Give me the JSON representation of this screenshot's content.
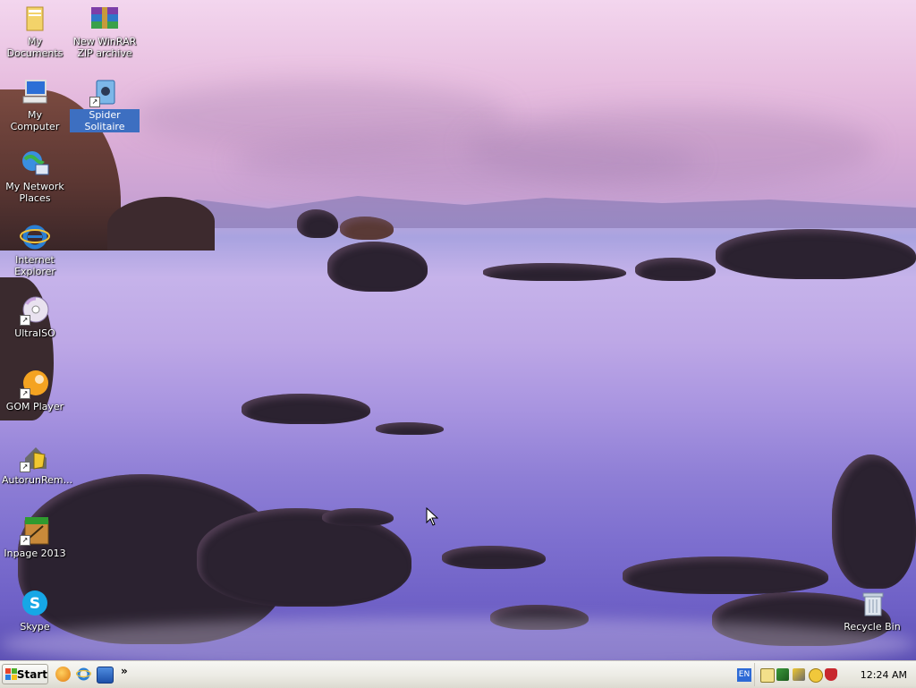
{
  "desktop": {
    "icons": [
      {
        "label": "My Documents",
        "selected": false
      },
      {
        "label": "New WinRAR ZIP archive",
        "selected": false
      },
      {
        "label": "My Computer",
        "selected": false
      },
      {
        "label": "Spider Solitaire",
        "selected": true
      },
      {
        "label": "My Network Places",
        "selected": false
      },
      {
        "label": "Internet Explorer",
        "selected": false
      },
      {
        "label": "UltraISO",
        "selected": false
      },
      {
        "label": "GOM Player",
        "selected": false
      },
      {
        "label": "AutorunRem...",
        "selected": false
      },
      {
        "label": "Inpage 2013",
        "selected": false
      },
      {
        "label": "Skype",
        "selected": false
      },
      {
        "label": "Recycle Bin",
        "selected": false
      }
    ]
  },
  "taskbar": {
    "start_label": "Start",
    "quick_launch_more": "»",
    "tray": {
      "language": "EN",
      "clock": "12:24 AM"
    }
  },
  "colors": {
    "selection": "#3d6fc1",
    "taskbar": "#ecebe4"
  }
}
